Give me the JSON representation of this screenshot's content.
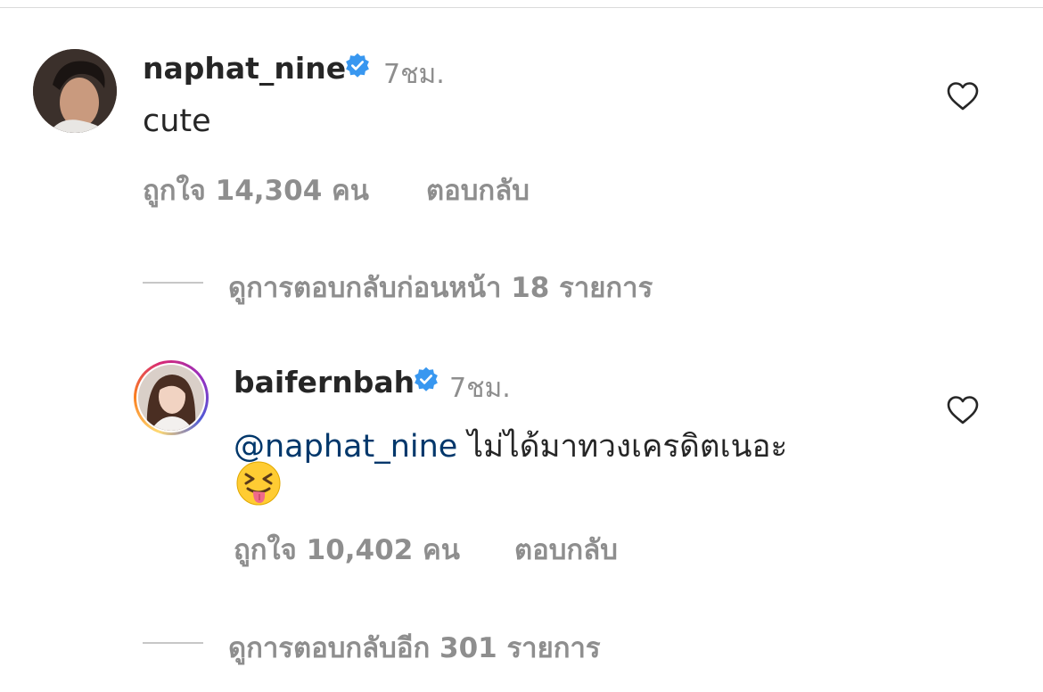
{
  "comments": [
    {
      "username": "naphat_nine",
      "time": "7ชม.",
      "text": "cute",
      "likes": "ถูกใจ 14,304 คน",
      "reply_label": "ตอบกลับ"
    },
    {
      "username": "baifernbah",
      "time": "7ชม.",
      "mention": "@naphat_nine",
      "text": " ไม่ได้มาทวงเครดิตเนอะ",
      "likes": "ถูกใจ 10,402 คน",
      "reply_label": "ตอบกลับ"
    }
  ],
  "view_previous_replies": "ดูการตอบกลับก่อนหน้า 18 รายการ",
  "view_more_replies": "ดูการตอบกลับอีก 301 รายการ",
  "colors": {
    "verified": "#3897f0",
    "mention": "#00376b",
    "secondary_text": "#8e8e8e"
  },
  "icons": [
    "verified-badge-icon",
    "heart-icon",
    "squinting-tongue-emoji"
  ]
}
